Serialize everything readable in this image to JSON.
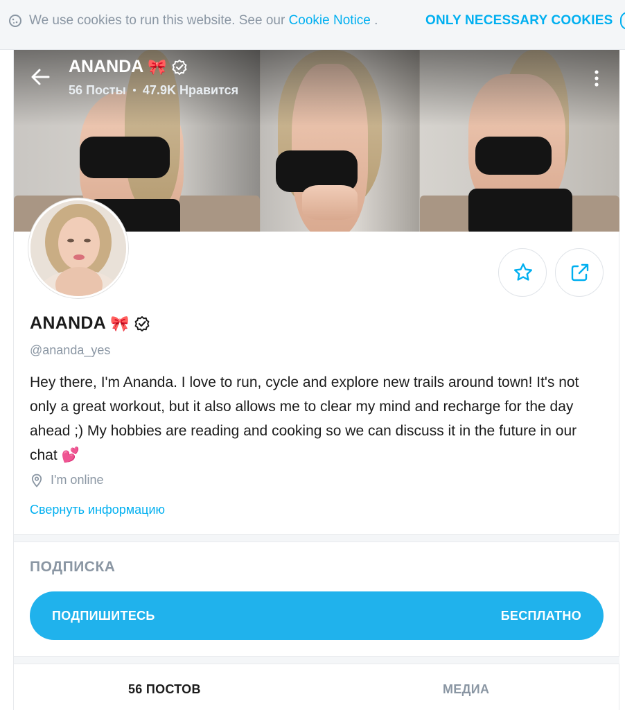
{
  "cookie_bar": {
    "text": "We use cookies to run this website. See our",
    "link": "Cookie Notice",
    "suffix": " .",
    "button": "ONLY NECESSARY COOKIES"
  },
  "profile": {
    "name": "ANANDA",
    "name_emoji": "🎀",
    "posts_stat": "56 Посты",
    "likes_stat": "47.9K Нравится",
    "handle": "@ananda_yes",
    "bio": "Hey there, I'm Ananda. I love to run, cycle and explore new trails around town! It's not only a great workout, but it also allows me to clear my mind and recharge for the day ahead ;) My hobbies are reading and cooking so we can discuss it in the future in our chat 💕",
    "location": "I'm online",
    "collapse_link": "Свернуть информацию"
  },
  "subscription": {
    "title": "ПОДПИСКА",
    "button_label": "ПОДПИШИТЕСЬ",
    "button_price": "БЕСПЛАТНО"
  },
  "tabs": [
    {
      "label": "56 ПОСТОВ",
      "active": true
    },
    {
      "label": "МЕДИА",
      "active": false
    }
  ],
  "colors": {
    "accent": "#00aff0",
    "button": "#20b2ec",
    "muted_text": "#8a96a3",
    "text": "#1b1b1b"
  },
  "icons": [
    "cookie-icon",
    "close-icon",
    "back-arrow-icon",
    "verified-icon",
    "more-vertical-icon",
    "star-icon",
    "share-icon",
    "location-pin-icon"
  ]
}
